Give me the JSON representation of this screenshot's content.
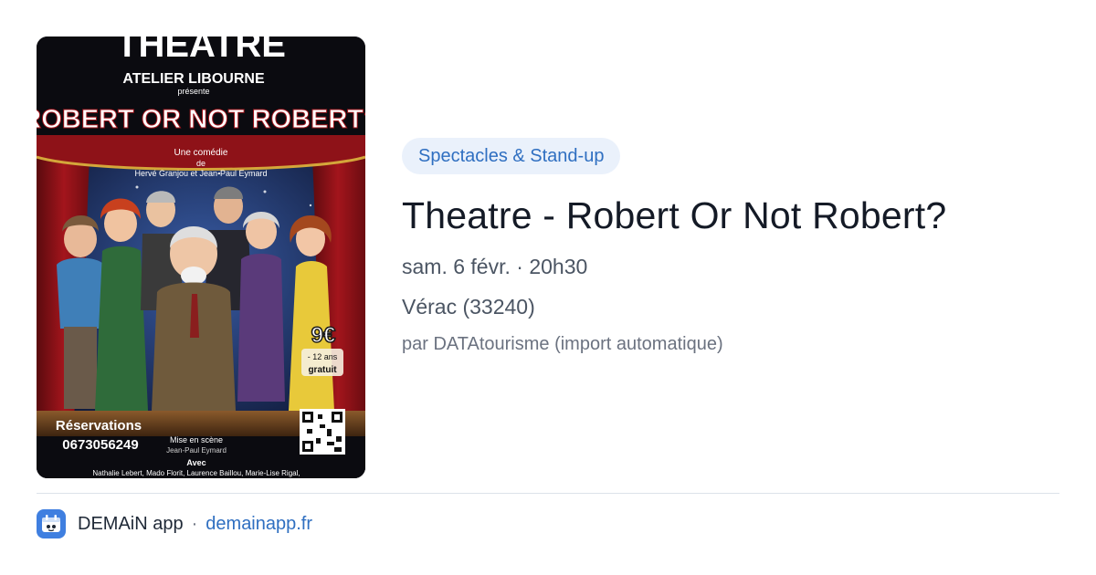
{
  "poster": {
    "icon": "event-poster-image",
    "title": "THEATRE",
    "company": "ATELIER LIBOURNE",
    "presents": "présente",
    "play": "ROBERT OR NOT ROBERT?",
    "genre": "Une comédie",
    "by_word": "de",
    "authors": "Hervé Granjou et Jean-Paul Eymard",
    "price": "9€",
    "under12": "- 12 ans",
    "free": "gratuit",
    "reservations_label": "Réservations",
    "phone": "0673056249",
    "staging_label": "Mise en scène",
    "director": "Jean-Paul Eymard",
    "with_label": "Avec",
    "cast": "Nathalie Lebert, Mado Florit, Laurence Baillou, Marie-Lise Rigal,"
  },
  "event": {
    "category": "Spectacles & Stand-up",
    "title": "Theatre - Robert Or Not Robert?",
    "datetime": "sam. 6 févr. · 20h30",
    "location": "Vérac (33240)",
    "source": "par DATAtourisme (import automatique)"
  },
  "footer": {
    "app_name": "DEMAiN app",
    "separator": "·",
    "link": "demainapp.fr"
  },
  "colors": {
    "accent": "#2f6fc1",
    "pill_bg": "#eaf1fb",
    "app_icon_bg": "#3f7fe0"
  }
}
